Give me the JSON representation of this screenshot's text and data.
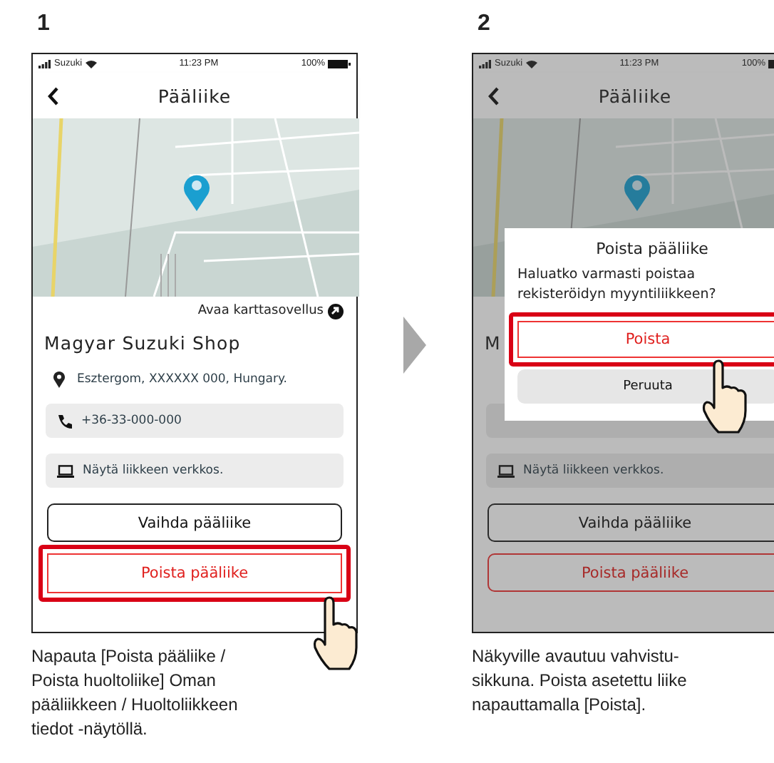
{
  "steps": [
    {
      "number": "1",
      "screen": {
        "carrier": "Suzuki",
        "time": "11:23 PM",
        "battery": "100%",
        "title": "Pääliike",
        "map_link": "Avaa karttasovellus",
        "shop_name": "Magyar Suzuki Shop",
        "address": "Esztergom, XXXXXX 000, Hungary.",
        "phone": "+36-33-000-000",
        "website": "Näytä liikkeen verkkos.",
        "dimmed": false,
        "buttons": [
          {
            "label": "Vaihda pääliike",
            "kind": "outline",
            "highlighted": false
          },
          {
            "label": "Poista pääliike",
            "kind": "danger",
            "highlighted": true
          }
        ]
      },
      "caption": "Napauta [Poista pääliike / Poista huoltoliike] Oman pääliikkeen / Huoltoliikkeen tiedot -näytöllä."
    },
    {
      "number": "2",
      "screen": {
        "carrier": "Suzuki",
        "time": "11:23 PM",
        "battery": "100%",
        "title": "Pääliike",
        "shop_name": "M",
        "website": "Näytä liikkeen verkkos.",
        "dimmed": true,
        "buttons": [
          {
            "label": "Vaihda pääliike",
            "kind": "outline",
            "highlighted": false
          },
          {
            "label": "Poista pääliike",
            "kind": "danger",
            "highlighted": false
          }
        ],
        "dialog": {
          "title": "Poista pääliike",
          "message": "Haluatko varmasti poistaa rekisteröidyn myyntiliikkeen?",
          "buttons": [
            {
              "label": "Poista",
              "kind": "danger",
              "highlighted": true
            },
            {
              "label": "Peruuta",
              "kind": "secondary",
              "highlighted": false
            }
          ]
        }
      },
      "caption": "Näkyville avautuu vahvistu-sikkuna. Poista asetettu liike napauttamalla [Poista]."
    }
  ]
}
